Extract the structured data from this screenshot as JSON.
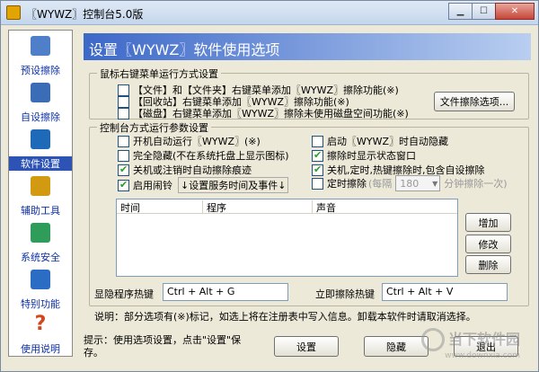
{
  "window": {
    "title": "〖WYWZ〗控制台5.0版"
  },
  "sidebar": {
    "items": [
      {
        "label": "预设擦除",
        "icon": "presets-icon",
        "color": "#4f7fc9"
      },
      {
        "label": "自设擦除",
        "icon": "eraser-disk-icon",
        "color": "#3a6db5"
      },
      {
        "label": "软件设置",
        "icon": "settings-grid-icon",
        "color": "#1f6ab8"
      },
      {
        "label": "辅助工具",
        "icon": "tool-icon",
        "color": "#d29a11"
      },
      {
        "label": "系统安全",
        "icon": "security-icon",
        "color": "#2f9c5a"
      },
      {
        "label": "特别功能",
        "icon": "special-icon",
        "color": "#2b6cc4"
      },
      {
        "label": "使用说明",
        "icon": "question-icon",
        "color": "#d4451c"
      }
    ]
  },
  "banner": {
    "title": "设置〖WYWZ〗软件使用选项"
  },
  "right_click_group": {
    "title": "鼠标右键菜单运行方式设置",
    "options": [
      {
        "label": "【文件】和【文件夹】右键菜单添加〖WYWZ〗擦除功能(※)",
        "checked": false
      },
      {
        "label": "【回收站】右键菜单添加〖WYWZ〗擦除功能(※)",
        "checked": false
      },
      {
        "label": "【磁盘】右键菜单添加〖WYWZ〗擦除未使用磁盘空间功能(※)",
        "checked": false
      }
    ],
    "file_options_button": "文件擦除选项..."
  },
  "console_group": {
    "title": "控制台方式运行参数设置",
    "left_options": [
      {
        "label": "开机自动运行〖WYWZ〗(※)",
        "checked": false
      },
      {
        "label": "完全隐藏(不在系统托盘上显示图标)",
        "checked": false
      },
      {
        "label": "关机或注销时自动擦除痕迹",
        "checked": true
      },
      {
        "label": "启用闹铃",
        "checked": true
      }
    ],
    "alarm_link": "↓设置服务时间及事件↓",
    "right_options": [
      {
        "label": "启动〖WYWZ〗时自动隐藏",
        "checked": false
      },
      {
        "label": "擦除时显示状态窗口",
        "checked": true
      },
      {
        "label": "关机,定时,热键擦除时,包含自设擦除",
        "checked": true
      },
      {
        "label": "定时擦除",
        "checked": false
      }
    ],
    "timer_prefix": "(每隔",
    "timer_value": "180",
    "timer_suffix": "分钟擦除一次)"
  },
  "events_table": {
    "columns": [
      "时间",
      "程序",
      "声音"
    ]
  },
  "event_buttons": {
    "add": "增加",
    "edit": "修改",
    "delete": "删除"
  },
  "hotkeys": {
    "show_hide_label": "显隐程序热键",
    "show_hide_value": "Ctrl + Alt + G",
    "erase_label": "立即擦除热键",
    "erase_value": "Ctrl + Alt + V"
  },
  "note": "说明：部分选项有(※)标记，如选上将在注册表中写入信息。卸载本软件时请取消选择。",
  "hint": "提示：使用选项设置，点击\"设置\"保存。",
  "footer_buttons": {
    "apply": "设置",
    "hide": "隐藏",
    "exit": "退出"
  },
  "watermark": {
    "text": "当下软件园",
    "url": "www.downxia.com"
  }
}
